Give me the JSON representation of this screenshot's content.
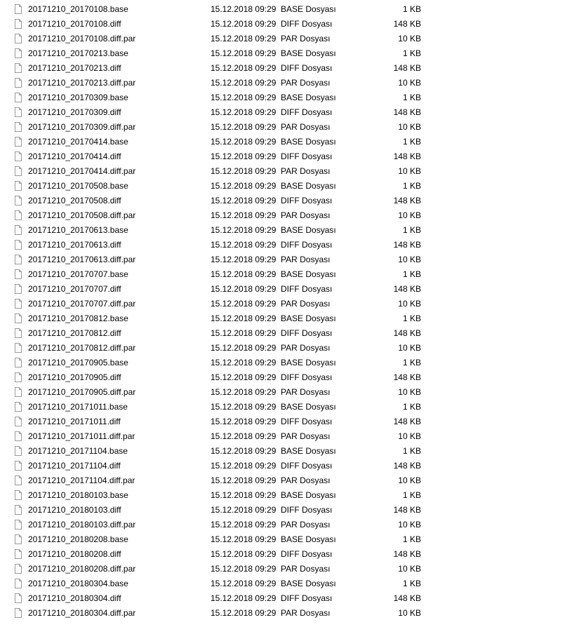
{
  "files": [
    {
      "name": "20171210_20170108.base",
      "date": "15.12.2018 09:29",
      "type": "BASE Dosyası",
      "size": "1 KB"
    },
    {
      "name": "20171210_20170108.diff",
      "date": "15.12.2018 09:29",
      "type": "DIFF Dosyası",
      "size": "148 KB"
    },
    {
      "name": "20171210_20170108.diff.par",
      "date": "15.12.2018 09:29",
      "type": "PAR Dosyası",
      "size": "10 KB"
    },
    {
      "name": "20171210_20170213.base",
      "date": "15.12.2018 09:29",
      "type": "BASE Dosyası",
      "size": "1 KB"
    },
    {
      "name": "20171210_20170213.diff",
      "date": "15.12.2018 09:29",
      "type": "DIFF Dosyası",
      "size": "148 KB"
    },
    {
      "name": "20171210_20170213.diff.par",
      "date": "15.12.2018 09:29",
      "type": "PAR Dosyası",
      "size": "10 KB"
    },
    {
      "name": "20171210_20170309.base",
      "date": "15.12.2018 09:29",
      "type": "BASE Dosyası",
      "size": "1 KB"
    },
    {
      "name": "20171210_20170309.diff",
      "date": "15.12.2018 09:29",
      "type": "DIFF Dosyası",
      "size": "148 KB"
    },
    {
      "name": "20171210_20170309.diff.par",
      "date": "15.12.2018 09:29",
      "type": "PAR Dosyası",
      "size": "10 KB"
    },
    {
      "name": "20171210_20170414.base",
      "date": "15.12.2018 09:29",
      "type": "BASE Dosyası",
      "size": "1 KB"
    },
    {
      "name": "20171210_20170414.diff",
      "date": "15.12.2018 09:29",
      "type": "DIFF Dosyası",
      "size": "148 KB"
    },
    {
      "name": "20171210_20170414.diff.par",
      "date": "15.12.2018 09:29",
      "type": "PAR Dosyası",
      "size": "10 KB"
    },
    {
      "name": "20171210_20170508.base",
      "date": "15.12.2018 09:29",
      "type": "BASE Dosyası",
      "size": "1 KB"
    },
    {
      "name": "20171210_20170508.diff",
      "date": "15.12.2018 09:29",
      "type": "DIFF Dosyası",
      "size": "148 KB"
    },
    {
      "name": "20171210_20170508.diff.par",
      "date": "15.12.2018 09:29",
      "type": "PAR Dosyası",
      "size": "10 KB"
    },
    {
      "name": "20171210_20170613.base",
      "date": "15.12.2018 09:29",
      "type": "BASE Dosyası",
      "size": "1 KB"
    },
    {
      "name": "20171210_20170613.diff",
      "date": "15.12.2018 09:29",
      "type": "DIFF Dosyası",
      "size": "148 KB"
    },
    {
      "name": "20171210_20170613.diff.par",
      "date": "15.12.2018 09:29",
      "type": "PAR Dosyası",
      "size": "10 KB"
    },
    {
      "name": "20171210_20170707.base",
      "date": "15.12.2018 09:29",
      "type": "BASE Dosyası",
      "size": "1 KB"
    },
    {
      "name": "20171210_20170707.diff",
      "date": "15.12.2018 09:29",
      "type": "DIFF Dosyası",
      "size": "148 KB"
    },
    {
      "name": "20171210_20170707.diff.par",
      "date": "15.12.2018 09:29",
      "type": "PAR Dosyası",
      "size": "10 KB"
    },
    {
      "name": "20171210_20170812.base",
      "date": "15.12.2018 09:29",
      "type": "BASE Dosyası",
      "size": "1 KB"
    },
    {
      "name": "20171210_20170812.diff",
      "date": "15.12.2018 09:29",
      "type": "DIFF Dosyası",
      "size": "148 KB"
    },
    {
      "name": "20171210_20170812.diff.par",
      "date": "15.12.2018 09:29",
      "type": "PAR Dosyası",
      "size": "10 KB"
    },
    {
      "name": "20171210_20170905.base",
      "date": "15.12.2018 09:29",
      "type": "BASE Dosyası",
      "size": "1 KB"
    },
    {
      "name": "20171210_20170905.diff",
      "date": "15.12.2018 09:29",
      "type": "DIFF Dosyası",
      "size": "148 KB"
    },
    {
      "name": "20171210_20170905.diff.par",
      "date": "15.12.2018 09:29",
      "type": "PAR Dosyası",
      "size": "10 KB"
    },
    {
      "name": "20171210_20171011.base",
      "date": "15.12.2018 09:29",
      "type": "BASE Dosyası",
      "size": "1 KB"
    },
    {
      "name": "20171210_20171011.diff",
      "date": "15.12.2018 09:29",
      "type": "DIFF Dosyası",
      "size": "148 KB"
    },
    {
      "name": "20171210_20171011.diff.par",
      "date": "15.12.2018 09:29",
      "type": "PAR Dosyası",
      "size": "10 KB"
    },
    {
      "name": "20171210_20171104.base",
      "date": "15.12.2018 09:29",
      "type": "BASE Dosyası",
      "size": "1 KB"
    },
    {
      "name": "20171210_20171104.diff",
      "date": "15.12.2018 09:29",
      "type": "DIFF Dosyası",
      "size": "148 KB"
    },
    {
      "name": "20171210_20171104.diff.par",
      "date": "15.12.2018 09:29",
      "type": "PAR Dosyası",
      "size": "10 KB"
    },
    {
      "name": "20171210_20180103.base",
      "date": "15.12.2018 09:29",
      "type": "BASE Dosyası",
      "size": "1 KB"
    },
    {
      "name": "20171210_20180103.diff",
      "date": "15.12.2018 09:29",
      "type": "DIFF Dosyası",
      "size": "148 KB"
    },
    {
      "name": "20171210_20180103.diff.par",
      "date": "15.12.2018 09:29",
      "type": "PAR Dosyası",
      "size": "10 KB"
    },
    {
      "name": "20171210_20180208.base",
      "date": "15.12.2018 09:29",
      "type": "BASE Dosyası",
      "size": "1 KB"
    },
    {
      "name": "20171210_20180208.diff",
      "date": "15.12.2018 09:29",
      "type": "DIFF Dosyası",
      "size": "148 KB"
    },
    {
      "name": "20171210_20180208.diff.par",
      "date": "15.12.2018 09:29",
      "type": "PAR Dosyası",
      "size": "10 KB"
    },
    {
      "name": "20171210_20180304.base",
      "date": "15.12.2018 09:29",
      "type": "BASE Dosyası",
      "size": "1 KB"
    },
    {
      "name": "20171210_20180304.diff",
      "date": "15.12.2018 09:29",
      "type": "DIFF Dosyası",
      "size": "148 KB"
    },
    {
      "name": "20171210_20180304.diff.par",
      "date": "15.12.2018 09:29",
      "type": "PAR Dosyası",
      "size": "10 KB"
    }
  ]
}
